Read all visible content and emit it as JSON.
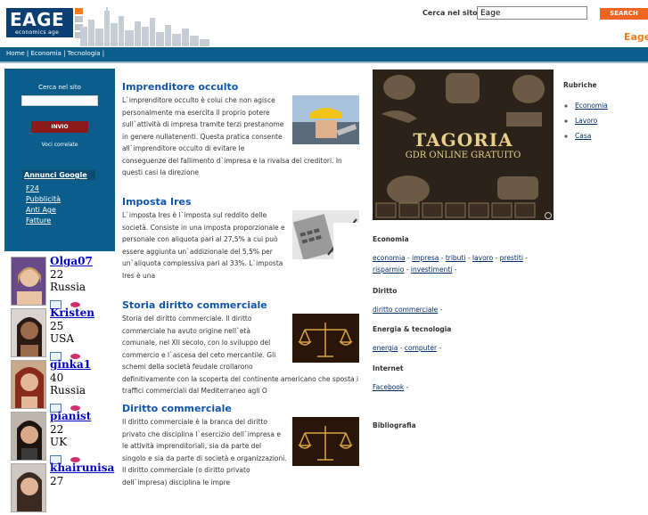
{
  "header": {
    "logo_text": "EAGE",
    "logo_subtitle": "economics age",
    "search_label": "Cerca nel sito",
    "search_value": "Eage",
    "search_button": "SEARCH",
    "corner_text": "Eage"
  },
  "breadcrumb": {
    "home": "Home",
    "economia": "Economia",
    "tecnologia": "Tecnologia",
    "sep": "|"
  },
  "leftbar": {
    "search_label": "Cerca nel sito",
    "submit_label": "INVIO",
    "voci_correlate": "Voci correlate",
    "annunci_label": "Annunci Google",
    "links": [
      "F24",
      "Pubblicità",
      "Anti Age",
      "Fatture"
    ]
  },
  "profiles": [
    {
      "name": "Olga07",
      "age": "22",
      "country": "Russia"
    },
    {
      "name": "Kristen",
      "age": "25",
      "country": "USA"
    },
    {
      "name": "ginka1",
      "age": "40",
      "country": "Russia"
    },
    {
      "name": "pianist",
      "age": "22",
      "country": "UK"
    },
    {
      "name": "khairunisa",
      "age": "27",
      "country": ""
    }
  ],
  "articles": [
    {
      "title": "Imprenditore occulto",
      "body": "L`imprenditore occulto è colui che non agisce personalmente ma esercita il proprio potere sull`attività di impresa tramite terzi prestanome in genere nullatenenti. Questa pratica consente all`imprenditore occulto di evitare le conseguenze del fallimento d`impresa e la rivalsa dei creditori. In questi casi la direzione"
    },
    {
      "title": "Imposta Ires",
      "body": "L`imposta Ires è l`imposta sul reddito delle società. Consiste in una imposta proporzionale e personale con aliquota pari al 27,5% a cui può essere aggiunta un`addizionale del 5,5% per un`aliquota complessiva pari al 33%. L`imposta Ires è una"
    },
    {
      "title": "Storia diritto commerciale",
      "body": "Storia del diritto commerciale. Il diritto commerciale ha avuto origine nell`età comunale, nel XII secolo, con lo sviluppo del commercio e l`ascesa del ceto mercantile. Gli schemi della società feudale crollarono definitivamente con la scoperta del continente americano che sposta i traffici commerciali dal Mediterraneo agli O"
    },
    {
      "title": "Diritto commerciale",
      "body": "Il diritto commerciale è la branca del diritto privato che disciplina l`esercizio dell`impresa e le attività imprenditoriali, sia da parte del singolo e sia da parte di società e organizzazioni. Il diritto commerciale (o diritto privato dell`impresa) disciplina le impre"
    }
  ],
  "ad": {
    "title": "TAGORIA",
    "subtitle": "GDR ONLINE GRATUITO"
  },
  "rubriche": {
    "title": "Rubriche",
    "items": [
      "Economia",
      "Lavoro",
      "Casa"
    ]
  },
  "tag_sections": [
    {
      "title": "Economia",
      "links": [
        "economia",
        "impresa",
        "tributi",
        "lavoro",
        "prestiti",
        "risparmio",
        "investimenti"
      ]
    },
    {
      "title": "Diritto",
      "links": [
        "diritto commerciale"
      ]
    },
    {
      "title": "Energia & tecnologia",
      "links": [
        "energia",
        "computer"
      ]
    },
    {
      "title": "Internet",
      "links": [
        "Facebook"
      ]
    },
    {
      "title": "Bibliografia",
      "links": []
    }
  ]
}
